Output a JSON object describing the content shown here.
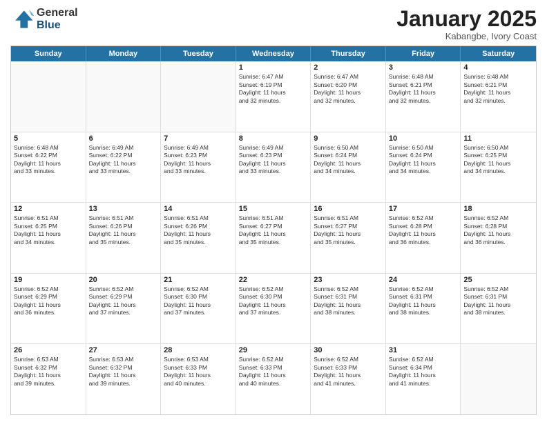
{
  "header": {
    "logo_general": "General",
    "logo_blue": "Blue",
    "month_title": "January 2025",
    "location": "Kabangbe, Ivory Coast"
  },
  "weekdays": [
    "Sunday",
    "Monday",
    "Tuesday",
    "Wednesday",
    "Thursday",
    "Friday",
    "Saturday"
  ],
  "rows": [
    [
      {
        "day": "",
        "lines": []
      },
      {
        "day": "",
        "lines": []
      },
      {
        "day": "",
        "lines": []
      },
      {
        "day": "1",
        "lines": [
          "Sunrise: 6:47 AM",
          "Sunset: 6:19 PM",
          "Daylight: 11 hours",
          "and 32 minutes."
        ]
      },
      {
        "day": "2",
        "lines": [
          "Sunrise: 6:47 AM",
          "Sunset: 6:20 PM",
          "Daylight: 11 hours",
          "and 32 minutes."
        ]
      },
      {
        "day": "3",
        "lines": [
          "Sunrise: 6:48 AM",
          "Sunset: 6:21 PM",
          "Daylight: 11 hours",
          "and 32 minutes."
        ]
      },
      {
        "day": "4",
        "lines": [
          "Sunrise: 6:48 AM",
          "Sunset: 6:21 PM",
          "Daylight: 11 hours",
          "and 32 minutes."
        ]
      }
    ],
    [
      {
        "day": "5",
        "lines": [
          "Sunrise: 6:48 AM",
          "Sunset: 6:22 PM",
          "Daylight: 11 hours",
          "and 33 minutes."
        ]
      },
      {
        "day": "6",
        "lines": [
          "Sunrise: 6:49 AM",
          "Sunset: 6:22 PM",
          "Daylight: 11 hours",
          "and 33 minutes."
        ]
      },
      {
        "day": "7",
        "lines": [
          "Sunrise: 6:49 AM",
          "Sunset: 6:23 PM",
          "Daylight: 11 hours",
          "and 33 minutes."
        ]
      },
      {
        "day": "8",
        "lines": [
          "Sunrise: 6:49 AM",
          "Sunset: 6:23 PM",
          "Daylight: 11 hours",
          "and 33 minutes."
        ]
      },
      {
        "day": "9",
        "lines": [
          "Sunrise: 6:50 AM",
          "Sunset: 6:24 PM",
          "Daylight: 11 hours",
          "and 34 minutes."
        ]
      },
      {
        "day": "10",
        "lines": [
          "Sunrise: 6:50 AM",
          "Sunset: 6:24 PM",
          "Daylight: 11 hours",
          "and 34 minutes."
        ]
      },
      {
        "day": "11",
        "lines": [
          "Sunrise: 6:50 AM",
          "Sunset: 6:25 PM",
          "Daylight: 11 hours",
          "and 34 minutes."
        ]
      }
    ],
    [
      {
        "day": "12",
        "lines": [
          "Sunrise: 6:51 AM",
          "Sunset: 6:25 PM",
          "Daylight: 11 hours",
          "and 34 minutes."
        ]
      },
      {
        "day": "13",
        "lines": [
          "Sunrise: 6:51 AM",
          "Sunset: 6:26 PM",
          "Daylight: 11 hours",
          "and 35 minutes."
        ]
      },
      {
        "day": "14",
        "lines": [
          "Sunrise: 6:51 AM",
          "Sunset: 6:26 PM",
          "Daylight: 11 hours",
          "and 35 minutes."
        ]
      },
      {
        "day": "15",
        "lines": [
          "Sunrise: 6:51 AM",
          "Sunset: 6:27 PM",
          "Daylight: 11 hours",
          "and 35 minutes."
        ]
      },
      {
        "day": "16",
        "lines": [
          "Sunrise: 6:51 AM",
          "Sunset: 6:27 PM",
          "Daylight: 11 hours",
          "and 35 minutes."
        ]
      },
      {
        "day": "17",
        "lines": [
          "Sunrise: 6:52 AM",
          "Sunset: 6:28 PM",
          "Daylight: 11 hours",
          "and 36 minutes."
        ]
      },
      {
        "day": "18",
        "lines": [
          "Sunrise: 6:52 AM",
          "Sunset: 6:28 PM",
          "Daylight: 11 hours",
          "and 36 minutes."
        ]
      }
    ],
    [
      {
        "day": "19",
        "lines": [
          "Sunrise: 6:52 AM",
          "Sunset: 6:29 PM",
          "Daylight: 11 hours",
          "and 36 minutes."
        ]
      },
      {
        "day": "20",
        "lines": [
          "Sunrise: 6:52 AM",
          "Sunset: 6:29 PM",
          "Daylight: 11 hours",
          "and 37 minutes."
        ]
      },
      {
        "day": "21",
        "lines": [
          "Sunrise: 6:52 AM",
          "Sunset: 6:30 PM",
          "Daylight: 11 hours",
          "and 37 minutes."
        ]
      },
      {
        "day": "22",
        "lines": [
          "Sunrise: 6:52 AM",
          "Sunset: 6:30 PM",
          "Daylight: 11 hours",
          "and 37 minutes."
        ]
      },
      {
        "day": "23",
        "lines": [
          "Sunrise: 6:52 AM",
          "Sunset: 6:31 PM",
          "Daylight: 11 hours",
          "and 38 minutes."
        ]
      },
      {
        "day": "24",
        "lines": [
          "Sunrise: 6:52 AM",
          "Sunset: 6:31 PM",
          "Daylight: 11 hours",
          "and 38 minutes."
        ]
      },
      {
        "day": "25",
        "lines": [
          "Sunrise: 6:52 AM",
          "Sunset: 6:31 PM",
          "Daylight: 11 hours",
          "and 38 minutes."
        ]
      }
    ],
    [
      {
        "day": "26",
        "lines": [
          "Sunrise: 6:53 AM",
          "Sunset: 6:32 PM",
          "Daylight: 11 hours",
          "and 39 minutes."
        ]
      },
      {
        "day": "27",
        "lines": [
          "Sunrise: 6:53 AM",
          "Sunset: 6:32 PM",
          "Daylight: 11 hours",
          "and 39 minutes."
        ]
      },
      {
        "day": "28",
        "lines": [
          "Sunrise: 6:53 AM",
          "Sunset: 6:33 PM",
          "Daylight: 11 hours",
          "and 40 minutes."
        ]
      },
      {
        "day": "29",
        "lines": [
          "Sunrise: 6:52 AM",
          "Sunset: 6:33 PM",
          "Daylight: 11 hours",
          "and 40 minutes."
        ]
      },
      {
        "day": "30",
        "lines": [
          "Sunrise: 6:52 AM",
          "Sunset: 6:33 PM",
          "Daylight: 11 hours",
          "and 41 minutes."
        ]
      },
      {
        "day": "31",
        "lines": [
          "Sunrise: 6:52 AM",
          "Sunset: 6:34 PM",
          "Daylight: 11 hours",
          "and 41 minutes."
        ]
      },
      {
        "day": "",
        "lines": []
      }
    ]
  ]
}
